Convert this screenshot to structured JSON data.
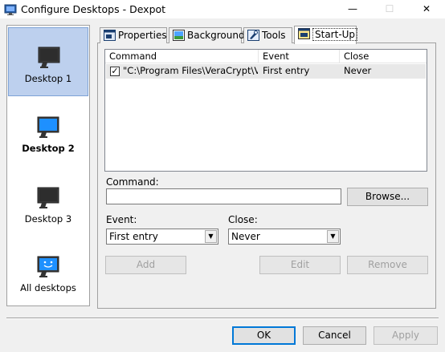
{
  "window": {
    "title": "Configure Desktops - Dexpot",
    "minimize": "—",
    "maximize": "☐",
    "close": "✕"
  },
  "sidebar": {
    "items": [
      {
        "label": "Desktop 1",
        "icon": "monitor-icon",
        "selected": true
      },
      {
        "label": "Desktop 2",
        "icon": "monitor-icon",
        "bold": true
      },
      {
        "label": "Desktop 3",
        "icon": "monitor-icon"
      },
      {
        "label": "All desktops",
        "icon": "monitor-smile-icon"
      }
    ]
  },
  "tabs": [
    {
      "label": "Properties",
      "icon": "properties-icon"
    },
    {
      "label": "Background",
      "icon": "background-icon"
    },
    {
      "label": "Tools",
      "icon": "tools-icon"
    },
    {
      "label": "Start-Up",
      "icon": "startup-icon",
      "active": true
    }
  ],
  "startup": {
    "columns": [
      "Command",
      "Event",
      "Close"
    ],
    "rows": [
      {
        "checked": true,
        "command": "\"C:\\Program Files\\VeraCrypt\\Ver...",
        "event": "First entry",
        "close": "Never"
      }
    ],
    "command_label": "Command:",
    "command_value": "",
    "browse_label": "Browse...",
    "event_label": "Event:",
    "event_value": "First entry",
    "close_label": "Close:",
    "close_value": "Never",
    "add_label": "Add",
    "edit_label": "Edit",
    "remove_label": "Remove"
  },
  "footer": {
    "ok_label": "OK",
    "cancel_label": "Cancel",
    "apply_label": "Apply"
  },
  "colors": {
    "selection": "#bdd0ee",
    "accent": "#0078d7",
    "monitor_screen": "#1e90ff"
  }
}
